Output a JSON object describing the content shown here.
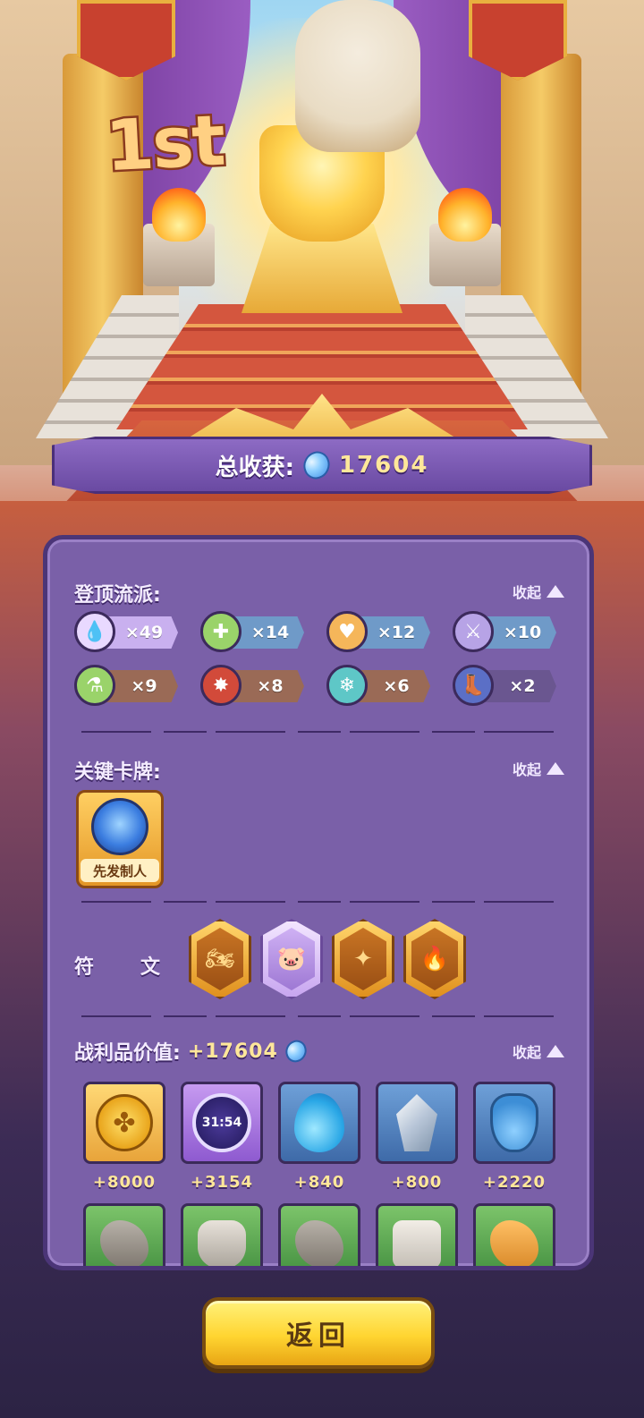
{
  "rank": "1st",
  "total": {
    "label": "总收获:",
    "value": "17604",
    "icon": "blue-gem-icon"
  },
  "genres": {
    "title": "登顶流派:",
    "collapse_label": "收起",
    "items": [
      {
        "icon": "water-drop-icon",
        "count": "×49",
        "color": "#e9d9ff",
        "tag_color": "#c9b0ef"
      },
      {
        "icon": "green-cross-icon",
        "count": "×14",
        "color": "#9ad36a",
        "tag_color": "#6f9ac8"
      },
      {
        "icon": "heart-icon",
        "count": "×12",
        "color": "#f5b65a",
        "tag_color": "#6f9ac8"
      },
      {
        "icon": "sword-icon",
        "count": "×10",
        "color": "#b7a3e6",
        "tag_color": "#6f9ac8"
      },
      {
        "icon": "green-potion-icon",
        "count": "×9",
        "color": "#9ad36a",
        "tag_color": "#9a6a56"
      },
      {
        "icon": "red-claw-icon",
        "count": "×8",
        "color": "#d24a3a",
        "tag_color": "#9a6a56"
      },
      {
        "icon": "snowflake-icon",
        "count": "×6",
        "color": "#5ec7c7",
        "tag_color": "#9a6a56"
      },
      {
        "icon": "boot-icon",
        "count": "×2",
        "color": "#5b6fc6",
        "tag_color": "#6a5690"
      }
    ]
  },
  "key_cards": {
    "title": "关键卡牌:",
    "collapse_label": "收起",
    "items": [
      {
        "label": "先发制人",
        "icon": "blue-spirit-icon"
      }
    ]
  },
  "runes": {
    "title": "符文:",
    "items": [
      {
        "icon": "motorcycle-icon",
        "style": "gold"
      },
      {
        "icon": "piggy-bank-icon",
        "style": "purple"
      },
      {
        "icon": "phoenix-icon",
        "style": "gold"
      },
      {
        "icon": "flame-feather-icon",
        "style": "gold"
      }
    ]
  },
  "loot": {
    "title": "战利品价值:",
    "value": "+17604",
    "collapse_label": "收起",
    "items": [
      {
        "icon": "gold-coin-icon",
        "value": "+8000",
        "style": "gold"
      },
      {
        "icon": "stopwatch-icon",
        "value": "+3154",
        "style": "purple",
        "text": "31:54"
      },
      {
        "icon": "water-drop-icon",
        "value": "+840",
        "style": "blue"
      },
      {
        "icon": "crystal-icon",
        "value": "+800",
        "style": "blue"
      },
      {
        "icon": "potion-bottle-icon",
        "value": "+2220",
        "style": "blue"
      }
    ],
    "second_row": [
      {
        "icon": "stone-icon",
        "style": "green"
      },
      {
        "icon": "bottle-icon",
        "style": "green"
      },
      {
        "icon": "stone-icon",
        "style": "green"
      },
      {
        "icon": "jar-icon",
        "style": "green"
      },
      {
        "icon": "bread-icon",
        "style": "green"
      }
    ]
  },
  "return_button": "返回"
}
